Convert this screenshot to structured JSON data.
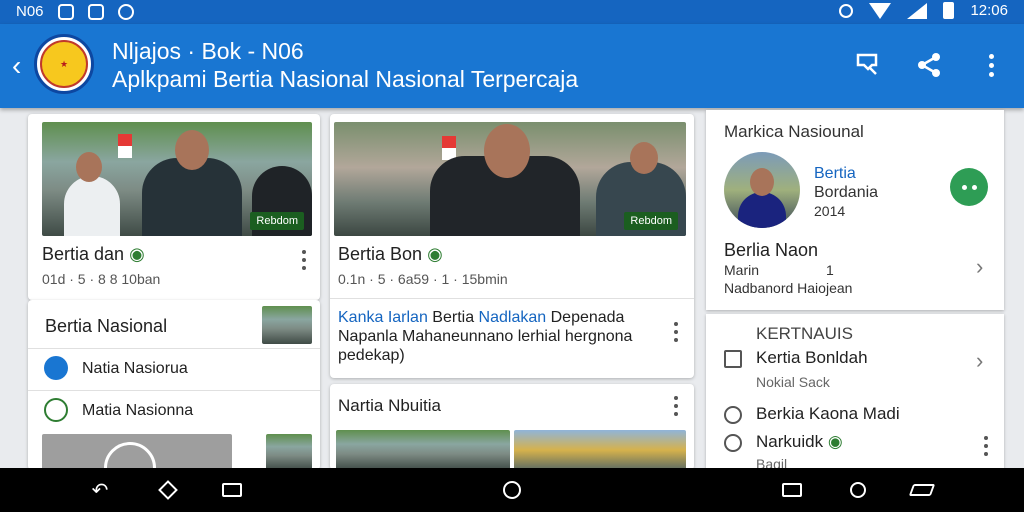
{
  "status_bar": {
    "carrier": "N06",
    "time": "12:06"
  },
  "app_bar": {
    "title": "Nljajos · Bok - N06",
    "subtitle": "Aplkpami Bertia Nasional Nasional Terpercaja"
  },
  "card1": {
    "badge": "Rebdom",
    "title": "Bertia dan",
    "meta": "01d · 5 · 8 8 10ban",
    "list_title": "Bertia Nasional",
    "list_title_prefix": "B",
    "items": [
      {
        "label": "Natia Nasiorua",
        "icon": "calendar-icon"
      },
      {
        "label": "Matia Nasionna",
        "icon": "badge-icon"
      }
    ]
  },
  "card2": {
    "badge": "Rebdom",
    "title": "Bertia Bon",
    "meta": "0.1n · 5 · 6a59 · 1 · 15bmin",
    "story_lead": "Kanka Iarlan",
    "story_mid": "Bertia",
    "story_hl": "Nadlakan",
    "story_rest": "Depenada Napanla Mahaneunnano lerhial hergnona pedekap)"
  },
  "card3": {
    "title": "Nartia Nbuitia"
  },
  "side": {
    "header": "Markica Nasiounal",
    "profile": {
      "name": "Bertia",
      "line2": "Bordania",
      "line3": "2014"
    },
    "featured": {
      "title": "Berlia Naon",
      "line1": "Marin",
      "line1b": "1",
      "line2": "Nadbanord Haiojean"
    },
    "section_label": "KERTNAUIS",
    "rows": [
      {
        "label": "Kertia Bonldah",
        "sub": "Nokial Sack",
        "icon": "clipboard-icon"
      },
      {
        "label": "Berkia Kaona Madi",
        "icon": "clock-icon"
      },
      {
        "label": "Narkuidk",
        "icon": "alert-icon"
      }
    ],
    "bottom_text": "Bagil"
  }
}
